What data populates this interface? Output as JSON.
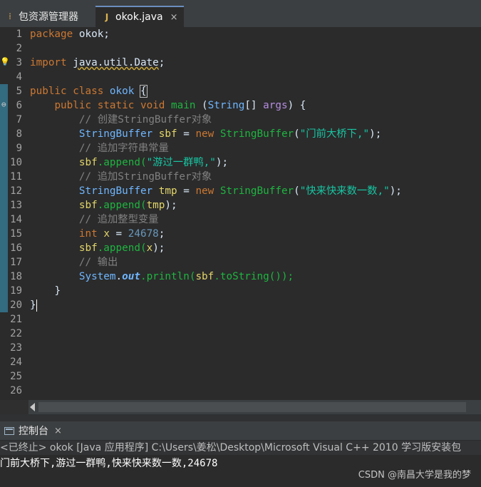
{
  "tabs": [
    {
      "label": "包资源管理器",
      "icon": "package-explorer-icon"
    },
    {
      "label": "okok.java",
      "icon": "java-file-icon",
      "close": "×"
    }
  ],
  "editor": {
    "line_numbers": [
      "1",
      "2",
      "3",
      "4",
      "5",
      "6",
      "7",
      "8",
      "9",
      "10",
      "11",
      "12",
      "13",
      "14",
      "15",
      "16",
      "17",
      "18",
      "19",
      "20",
      "21",
      "22",
      "23",
      "24",
      "25",
      "26"
    ],
    "lines": {
      "l1": {
        "kw": "package",
        "rest": " okok;"
      },
      "l3": {
        "kw": "import",
        "pkg": "java.util.Date",
        "end": ";"
      },
      "l5": {
        "kw1": "public",
        "kw2": "class",
        "name": "okok",
        "brace": "{"
      },
      "l6": {
        "kw1": "public",
        "kw2": "static",
        "kw3": "void",
        "name": "main",
        "open": " (",
        "type": "String",
        "arr": "[] ",
        "arg": "args",
        "close": ") {"
      },
      "l7": "// 创建StringBuffer对象",
      "l8": {
        "type": "StringBuffer",
        "var": "sbf",
        "eq": " = ",
        "kw": "new",
        "type2": "StringBuffer",
        "str": "\"门前大桥下,\"",
        "end": ");"
      },
      "l9": "// 追加字符串常量",
      "l10": {
        "var": "sbf",
        "call": ".append(",
        "str": "\"游过一群鸭,\"",
        "end": ");"
      },
      "l11": "// 追加StringBuffer对象",
      "l12": {
        "type": "StringBuffer",
        "var": "tmp",
        "eq": " = ",
        "kw": "new",
        "type2": "StringBuffer",
        "str": "\"快来快来数一数,\"",
        "end": ");"
      },
      "l13": {
        "var": "sbf",
        "call": ".append(",
        "arg": "tmp",
        "end": ");"
      },
      "l14": "// 追加整型变量",
      "l15": {
        "kw": "int",
        "var": "x",
        "eq": " = ",
        "num": "24678",
        "end": ";"
      },
      "l16": {
        "var": "sbf",
        "call": ".append(",
        "arg": "x",
        "end": ");"
      },
      "l17": "// 输出",
      "l18": {
        "cls": "System",
        "dot": ".",
        "field": "out",
        "call": ".println(",
        "var": "sbf",
        "call2": ".toString());"
      },
      "l19": "}",
      "l20": "}"
    }
  },
  "console": {
    "tab_label": "控制台",
    "tab_close": "×",
    "status": "<已终止> okok [Java 应用程序] C:\\Users\\姜松\\Desktop\\Microsoft Visual C++ 2010 学习版安装包",
    "output": "门前大桥下,游过一群鸭,快来快来数一数,24678",
    "watermark": "CSDN @南昌大学是我的梦"
  }
}
